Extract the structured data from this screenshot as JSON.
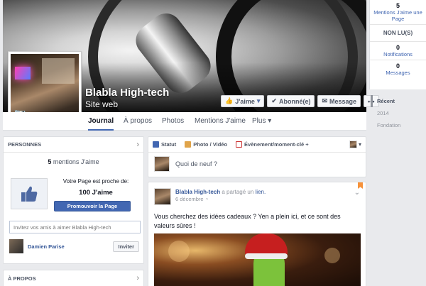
{
  "page": {
    "title": "Blabla High-tech",
    "category": "Site web"
  },
  "actions": {
    "like": "J'aime",
    "subscribed": "Abonné(e)",
    "message": "Message",
    "more": "•••"
  },
  "nav": {
    "tabs": [
      {
        "label": "Journal",
        "active": true
      },
      {
        "label": "À propos",
        "active": false
      },
      {
        "label": "Photos",
        "active": false
      },
      {
        "label": "Mentions J'aime",
        "active": false
      },
      {
        "label": "Plus",
        "active": false
      }
    ]
  },
  "rail": {
    "likes_count": "5",
    "likes_label": "Mentions J'aime une Page",
    "unread": "NON LU(S)",
    "notifications_count": "0",
    "notifications_label": "Notifications",
    "messages_count": "0",
    "messages_label": "Messages",
    "timeline": [
      "Récent",
      "2014",
      "Fondation"
    ]
  },
  "people": {
    "header": "PERSONNES",
    "likes_count": "5",
    "likes_label": "mentions J'aime",
    "near_label": "Votre Page est proche de:",
    "near_count": "100 J'aime",
    "promote": "Promouvoir la Page",
    "invite_placeholder": "Invitez vos amis à aimer Blabla High-tech",
    "friend_name": "Damien Parise",
    "invite_button": "Inviter"
  },
  "about": {
    "header": "À PROPOS"
  },
  "composer": {
    "status": "Statut",
    "photo": "Photo / Vidéo",
    "event": "Évènement/moment-clé +",
    "placeholder": "Quoi de neuf ?"
  },
  "post": {
    "author": "Blabla High-tech",
    "shared": "a partagé un",
    "link": "lien.",
    "date": "6 décembre",
    "text": "Vous cherchez des idées cadeaux ? Yen a plein ici, et ce sont des valeurs sûres !"
  },
  "colors": {
    "facebook_blue": "#4267b2",
    "link_blue": "#365899",
    "background": "#e9eaed"
  }
}
